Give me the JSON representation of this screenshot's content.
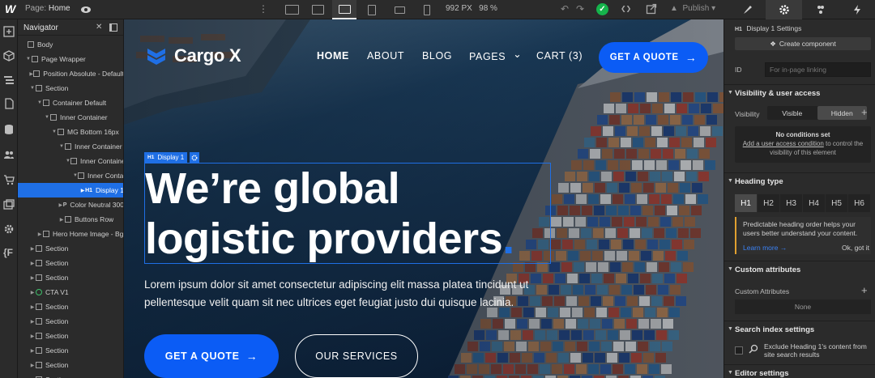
{
  "topbar": {
    "page_label": "Page:",
    "page_value": "Home",
    "viewport_width": "992 PX",
    "zoom": "98 %",
    "publish_label": "Publish",
    "publish_caret": "▾",
    "code_glyph": "❮❯"
  },
  "navigator": {
    "title": "Navigator",
    "items": [
      {
        "label": "Body"
      },
      {
        "label": "Page Wrapper"
      },
      {
        "label": "Position Absolute - Default"
      },
      {
        "label": "Section"
      },
      {
        "label": "Container Default"
      },
      {
        "label": "Inner Container"
      },
      {
        "label": "MG Bottom 16px"
      },
      {
        "label": "Inner Container"
      },
      {
        "label": "Inner Container"
      },
      {
        "label": "Inner Container"
      },
      {
        "label": "Display 1",
        "tag": "H1"
      },
      {
        "label": "Color Neutral 300",
        "tag": "P"
      },
      {
        "label": "Buttons Row"
      },
      {
        "label": "Hero Home Image - Bg"
      },
      {
        "label": "Section"
      },
      {
        "label": "Section"
      },
      {
        "label": "Section"
      },
      {
        "label": "CTA V1"
      },
      {
        "label": "Section"
      },
      {
        "label": "Section"
      },
      {
        "label": "Section"
      },
      {
        "label": "Section"
      },
      {
        "label": "Section"
      },
      {
        "label": "Section"
      }
    ]
  },
  "site": {
    "logo_text": "Cargo X",
    "nav": [
      "HOME",
      "ABOUT",
      "BLOG",
      "PAGES",
      "CART (3)"
    ],
    "header_cta": "GET A QUOTE",
    "selection_badge": "Display 1",
    "selection_tag": "H1",
    "hero_title_line1": "We’re global",
    "hero_title_line2": "logistic providers",
    "hero_title_dot": ".",
    "hero_paragraph": "Lorem ipsum dolor sit amet consectetur adipiscing elit massa platea tincidunt ut pellentesque velit quam sit nec ultrices eget feugiat justo dui quisque lacinia.",
    "btn_primary": "GET A QUOTE",
    "btn_secondary": "OUR SERVICES",
    "arrow_glyph": "→",
    "caret_glyph": "⌄"
  },
  "panel": {
    "title_tag": "H1",
    "title": "Display 1 Settings",
    "create_component": "Create component",
    "id_label": "ID",
    "id_placeholder": "For in-page linking",
    "visibility_section": "Visibility & user access",
    "visibility_label": "Visibility",
    "visibility_options": [
      "Visible",
      "Hidden"
    ],
    "no_conditions_title": "No conditions set",
    "no_conditions_link": "Add a user access condition",
    "no_conditions_rest": " to control the visibility of this element",
    "heading_section": "Heading type",
    "heading_options": [
      "H1",
      "H2",
      "H3",
      "H4",
      "H5",
      "H6"
    ],
    "heading_selected": "H1",
    "tip_text": "Predictable heading order helps your users better understand your content.",
    "tip_learn": "Learn more →",
    "tip_ok": "Ok, got it",
    "custom_attrs_section": "Custom attributes",
    "custom_attrs_label": "Custom Attributes",
    "custom_attrs_none": "None",
    "search_section": "Search index settings",
    "search_exclude": "Exclude Heading 1's content from site search results",
    "editor_section": "Editor settings"
  },
  "colors": {
    "accent": "#1f6fe5",
    "brand_button": "#0b5cf5",
    "status_ok": "#15b34b"
  },
  "icons": {
    "rail": [
      "add-icon",
      "box-icon",
      "navigator-icon",
      "pages-icon",
      "cms-icon",
      "users-icon",
      "ecommerce-icon",
      "assets-icon",
      "settings-icon",
      "variables-icon"
    ],
    "panel_tabs": [
      "style-brush-icon",
      "settings-gear-icon",
      "interactions-icon",
      "lightning-icon"
    ]
  }
}
